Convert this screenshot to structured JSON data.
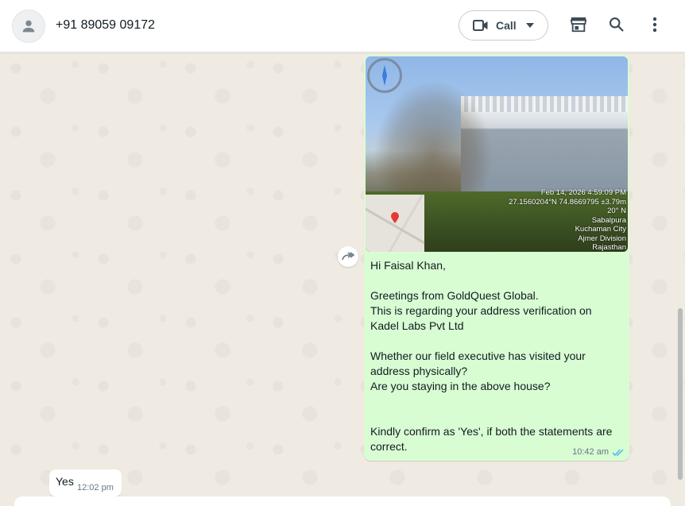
{
  "header": {
    "contact_name": "+91 89059 09172",
    "call_label": "Call",
    "icons": [
      "person-icon",
      "video-call-icon",
      "dropdown-icon",
      "shop-icon",
      "search-icon",
      "more-options-icon"
    ]
  },
  "messages": [
    {
      "direction": "outgoing",
      "image_overlay": {
        "lines": [
          "Feb 14, 2026 4:59:09 PM",
          "27.1560204°N 74.8669795 ±3.79m",
          "20° N",
          "Sabalpura",
          "Kuchaman City",
          "Ajmer Division",
          "Rajasthan"
        ]
      },
      "text": "Hi Faisal Khan,\n\nGreetings from GoldQuest Global.\nThis is regarding your address verification on Kadel Labs Pvt Ltd\n\nWhether our field executive has visited your address physically?\nAre you staying in the above house?\n\n\nKindly confirm as 'Yes', if both the statements are correct.",
      "time": "10:42 am",
      "status": "read",
      "tick_color": "#53bdeb"
    },
    {
      "direction": "incoming",
      "text": "Yes",
      "time": "12:02 pm"
    }
  ],
  "colors": {
    "outgoing_bubble": "#d9fdd3",
    "incoming_bubble": "#ffffff",
    "chat_background": "#efeae2"
  }
}
